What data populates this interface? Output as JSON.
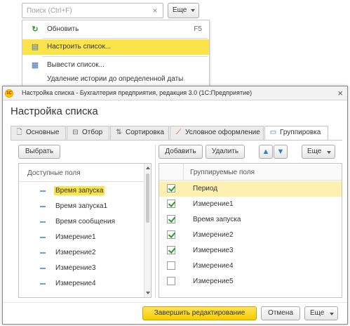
{
  "search": {
    "placeholder": "Поиск (Ctrl+F)",
    "clear_icon": "×"
  },
  "top_more_button": "Еще",
  "menu": {
    "items": [
      {
        "label": "Обновить",
        "shortcut": "F5",
        "icon": "refresh-icon"
      },
      {
        "label": "Настроить список...",
        "shortcut": "",
        "icon": "settings-list-icon"
      },
      {
        "label": "Вывести список...",
        "shortcut": "",
        "icon": "output-list-icon"
      },
      {
        "label": "Удаление истории до определенной даты",
        "shortcut": "",
        "icon": ""
      }
    ]
  },
  "dialog": {
    "window_title": "Настройка списка - Бухгалтерия предприятия, редакция 3.0  (1С:Предприятие)",
    "logo_text": "1С",
    "heading": "Настройка списка",
    "close_glyph": "×",
    "tabs": [
      {
        "label": "Основные",
        "icon": "document-icon"
      },
      {
        "label": "Отбор",
        "icon": "filter-icon"
      },
      {
        "label": "Сортировка",
        "icon": "sort-icon"
      },
      {
        "label": "Условное оформление",
        "icon": "conditional-format-icon"
      },
      {
        "label": "Группировка",
        "icon": "grouping-icon"
      }
    ],
    "active_tab": "Группировка",
    "left": {
      "select_button": "Выбрать",
      "header": "Доступные поля",
      "items": [
        "Время запуска",
        "Время запуска1",
        "Время сообщения",
        "Измерение1",
        "Измерение2",
        "Измерение3",
        "Измерение4"
      ],
      "selected": "Время запуска"
    },
    "right": {
      "add_button": "Добавить",
      "delete_button": "Удалить",
      "more_button": "Еще",
      "header": "Группируемые поля",
      "rows": [
        {
          "label": "Период",
          "checked": true
        },
        {
          "label": "Измерение1",
          "checked": true
        },
        {
          "label": "Время запуска",
          "checked": true
        },
        {
          "label": "Измерение2",
          "checked": true
        },
        {
          "label": "Измерение3",
          "checked": true
        },
        {
          "label": "Измерение4",
          "checked": false
        },
        {
          "label": "Измерение5",
          "checked": false
        }
      ],
      "selected_row": "Период"
    },
    "footer": {
      "finish_button": "Завершить редактирование",
      "cancel_button": "Отмена",
      "more_button": "Еще"
    }
  },
  "colors": {
    "accent_yellow": "#fbe44a",
    "selected_row": "#fdf0b0",
    "check_green": "#2a9a2a",
    "arrow_blue": "#2f7fd8"
  }
}
